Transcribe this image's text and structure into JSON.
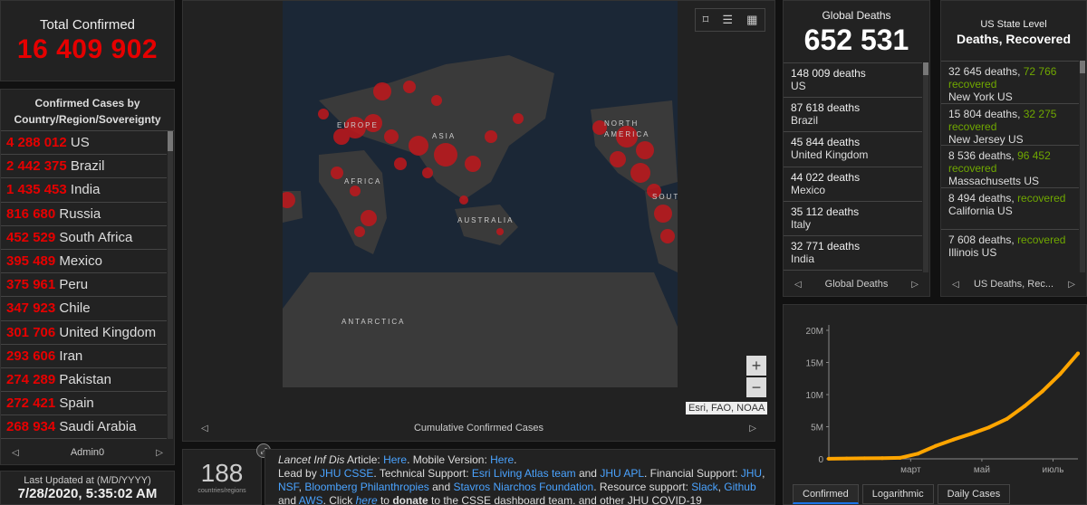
{
  "total": {
    "label": "Total Confirmed",
    "value": "16 409 902"
  },
  "cases": {
    "header": "Confirmed Cases by Country/Region/Sovereignty",
    "rows": [
      {
        "v": "4 288 012",
        "n": "US"
      },
      {
        "v": "2 442 375",
        "n": "Brazil"
      },
      {
        "v": "1 435 453",
        "n": "India"
      },
      {
        "v": "816 680",
        "n": "Russia"
      },
      {
        "v": "452 529",
        "n": "South Africa"
      },
      {
        "v": "395 489",
        "n": "Mexico"
      },
      {
        "v": "375 961",
        "n": "Peru"
      },
      {
        "v": "347 923",
        "n": "Chile"
      },
      {
        "v": "301 706",
        "n": "United Kingdom"
      },
      {
        "v": "293 606",
        "n": "Iran"
      },
      {
        "v": "274 289",
        "n": "Pakistan"
      },
      {
        "v": "272 421",
        "n": "Spain"
      },
      {
        "v": "268 934",
        "n": "Saudi Arabia"
      }
    ],
    "footer": "Admin0"
  },
  "updated": {
    "label": "Last Updated at (M/D/YYYY)",
    "value": "7/28/2020, 5:35:02 AM"
  },
  "map": {
    "footer": "Cumulative Confirmed Cases",
    "attribution": "Esri, FAO, NOAA",
    "labels": {
      "europe": "EUROPE",
      "asia": "ASIA",
      "africa": "AFRICA",
      "australia": "AUSTRALIA",
      "antarctica": "ANTARCTICA",
      "north_america": "NORTH AMERICA",
      "south": "SOUT"
    },
    "zoom_in": "+",
    "zoom_out": "−"
  },
  "count": {
    "value": "188",
    "label": "countries/regions"
  },
  "lancet": {
    "t1": "Lancet Inf Dis",
    "t2": " Article: ",
    "here1": "Here",
    "t3": ". Mobile Version: ",
    "here2": "Here",
    "t4": ".",
    "t5": "Lead by ",
    "jhu": "JHU CSSE",
    "t6": ". Technical Support: ",
    "esri": "Esri Living Atlas team",
    "t7": " and ",
    "jhuapl": "JHU APL",
    "t8": ". Financial Support: ",
    "jhu2": "JHU",
    "t9": ", ",
    "nsf": "NSF",
    "t10": ", ",
    "bloom": "Bloomberg Philanthropies",
    "t11": " and ",
    "stav": "Stavros Niarchos Foundation",
    "t12": ". Resource support: ",
    "slack": "Slack",
    "t13": ", ",
    "github": "Github",
    "t14": " and ",
    "aws": "AWS",
    "t15": ". Click ",
    "here3": "here",
    "t16": " to ",
    "donate": "donate",
    "t17": " to the CSSE dashboard team, and other JHU COVID-19"
  },
  "global_deaths": {
    "label": "Global Deaths",
    "value": "652 531",
    "rows": [
      {
        "d": "148 009 deaths",
        "n": "US"
      },
      {
        "d": "87 618 deaths",
        "n": "Brazil"
      },
      {
        "d": "45 844 deaths",
        "n": "United Kingdom"
      },
      {
        "d": "44 022 deaths",
        "n": "Mexico"
      },
      {
        "d": "35 112 deaths",
        "n": "Italy"
      },
      {
        "d": "32 771 deaths",
        "n": "India"
      }
    ],
    "footer": "Global Deaths"
  },
  "us_deaths": {
    "label": "US State Level",
    "label2": "Deaths, Recovered",
    "rows": [
      {
        "d": "32 645 deaths, ",
        "r": "72 766",
        "rl": "recovered",
        "n": "New York US"
      },
      {
        "d": "15 804 deaths, ",
        "r": "32 275",
        "rl": "recovered",
        "n": "New Jersey US"
      },
      {
        "d": "8 536 deaths, ",
        "r": "96 452",
        "rl": "recovered",
        "n": "Massachusetts US"
      },
      {
        "d": "8 494 deaths, ",
        "r": "",
        "rl": "recovered",
        "n": "California US"
      },
      {
        "d": "7 608 deaths, ",
        "r": "",
        "rl": "recovered",
        "n": "Illinois US"
      }
    ],
    "footer": "US Deaths, Rec..."
  },
  "tabs": [
    "Confirmed",
    "Logarithmic",
    "Daily Cases"
  ],
  "colors": {
    "accent_red": "#e60000",
    "recovered_green": "#70a800",
    "line_orange": "#ffa500",
    "link_blue": "#4aa3ff"
  },
  "chart_data": {
    "type": "line",
    "yticks": [
      "0",
      "5M",
      "10M",
      "15M",
      "20M"
    ],
    "ylim": [
      0,
      20
    ],
    "xticks": [
      "март",
      "май",
      "июль"
    ],
    "x": [
      0,
      0.5,
      1,
      1.5,
      2,
      2.5,
      3,
      3.5,
      4,
      4.5,
      5,
      5.5,
      6,
      6.5,
      7
    ],
    "series": [
      {
        "values": [
          0.01,
          0.05,
          0.08,
          0.1,
          0.15,
          0.8,
          2.0,
          3.0,
          3.9,
          4.9,
          6.2,
          8.2,
          10.5,
          13.2,
          16.4
        ]
      }
    ],
    "xtick_pos": [
      2.3,
      4.3,
      6.3
    ]
  }
}
